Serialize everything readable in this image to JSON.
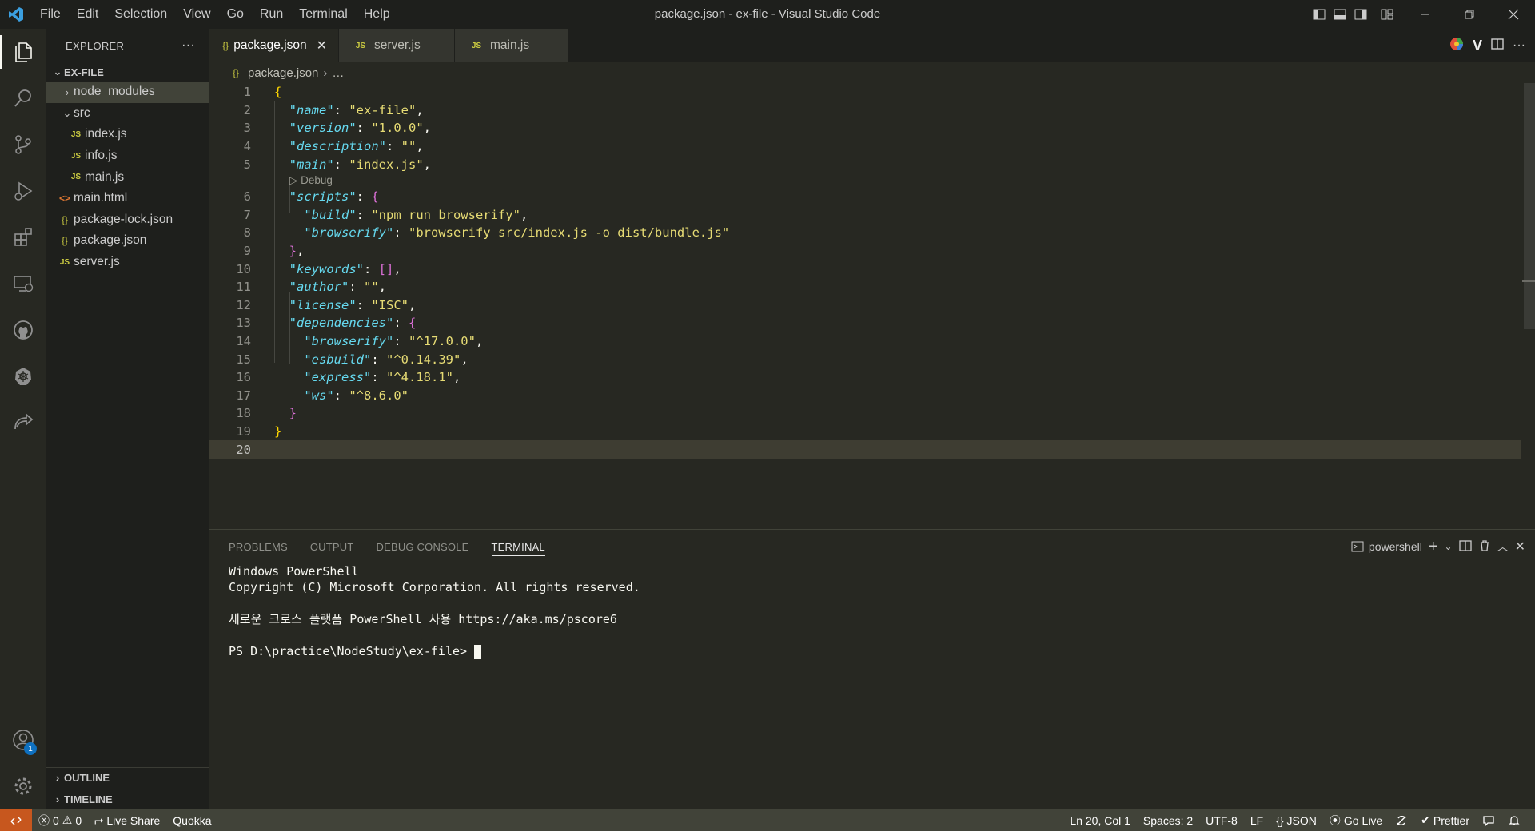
{
  "window": {
    "title": "package.json - ex-file - Visual Studio Code",
    "menu": [
      "File",
      "Edit",
      "Selection",
      "View",
      "Go",
      "Run",
      "Terminal",
      "Help"
    ]
  },
  "activity_bar": {
    "items": [
      "explorer-icon",
      "search-icon",
      "source-control-icon",
      "run-debug-icon",
      "extensions-icon",
      "remote-explorer-icon",
      "github-icon",
      "kubernetes-icon",
      "live-share-icon"
    ],
    "accounts_badge": "1"
  },
  "sidebar": {
    "title": "EXPLORER",
    "more": "···",
    "root": "EX-FILE",
    "tree": [
      {
        "name": "node_modules",
        "type": "folder",
        "twisty": "›"
      },
      {
        "name": "src",
        "type": "folder",
        "twisty": "⌄"
      },
      {
        "name": "index.js",
        "type": "js",
        "icon": "JS"
      },
      {
        "name": "info.js",
        "type": "js",
        "icon": "JS"
      },
      {
        "name": "main.js",
        "type": "js",
        "icon": "JS"
      },
      {
        "name": "main.html",
        "type": "html",
        "icon": "<>"
      },
      {
        "name": "package-lock.json",
        "type": "json",
        "icon": "{}"
      },
      {
        "name": "package.json",
        "type": "json",
        "icon": "{}"
      },
      {
        "name": "server.js",
        "type": "js",
        "icon": "JS"
      }
    ],
    "outline": "OUTLINE",
    "timeline": "TIMELINE"
  },
  "tabs": [
    {
      "label": "package.json",
      "icon": "{}",
      "active": true,
      "close": "✕"
    },
    {
      "label": "server.js",
      "icon": "JS",
      "active": false
    },
    {
      "label": "main.js",
      "icon": "JS",
      "active": false
    }
  ],
  "breadcrumb": {
    "file": "package.json",
    "icon": "{}",
    "rest": "…"
  },
  "editor": {
    "codelens": "▷ Debug",
    "lines": [
      "1",
      "2",
      "3",
      "4",
      "5",
      "6",
      "7",
      "8",
      "9",
      "10",
      "11",
      "12",
      "13",
      "14",
      "15",
      "16",
      "17",
      "18",
      "19",
      "20"
    ],
    "code": {
      "name_key": "\"name\"",
      "name_val": "\"ex-file\"",
      "version_key": "\"version\"",
      "version_val": "\"1.0.0\"",
      "description_key": "\"description\"",
      "description_val": "\"\"",
      "main_key": "\"main\"",
      "main_val": "\"index.js\"",
      "scripts_key": "\"scripts\"",
      "build_key": "\"build\"",
      "build_val": "\"npm run browserify\"",
      "browserify_key": "\"browserify\"",
      "browserify_val": "\"browserify src/index.js -o dist/bundle.js\"",
      "keywords_key": "\"keywords\"",
      "author_key": "\"author\"",
      "author_val": "\"\"",
      "license_key": "\"license\"",
      "license_val": "\"ISC\"",
      "dependencies_key": "\"dependencies\"",
      "dep_browserify_key": "\"browserify\"",
      "dep_browserify_val": "\"^17.0.0\"",
      "dep_esbuild_key": "\"esbuild\"",
      "dep_esbuild_val": "\"^0.14.39\"",
      "dep_express_key": "\"express\"",
      "dep_express_val": "\"^4.18.1\"",
      "dep_ws_key": "\"ws\"",
      "dep_ws_val": "\"^8.6.0\""
    }
  },
  "panel": {
    "tabs": [
      "PROBLEMS",
      "OUTPUT",
      "DEBUG CONSOLE",
      "TERMINAL"
    ],
    "active_tab": "TERMINAL",
    "shell": "powershell",
    "terminal_lines": [
      "Windows PowerShell",
      "Copyright (C) Microsoft Corporation. All rights reserved.",
      "",
      "새로운 크로스 플랫폼 PowerShell 사용 https://aka.ms/pscore6",
      "",
      "PS D:\\practice\\NodeStudy\\ex-file> "
    ]
  },
  "status_bar": {
    "errors": "0",
    "warnings": "0",
    "live_share": "Live Share",
    "quokka": "Quokka",
    "position": "Ln 20, Col 1",
    "spaces": "Spaces: 2",
    "encoding": "UTF-8",
    "eol": "LF",
    "language": "JSON",
    "go_live": "Go Live",
    "prettier": "Prettier"
  },
  "colors": {
    "accent_remote": "#c7571e",
    "statusbar": "#414339",
    "editor_bg": "#272822",
    "sidebar_bg": "#1e1f1c"
  }
}
